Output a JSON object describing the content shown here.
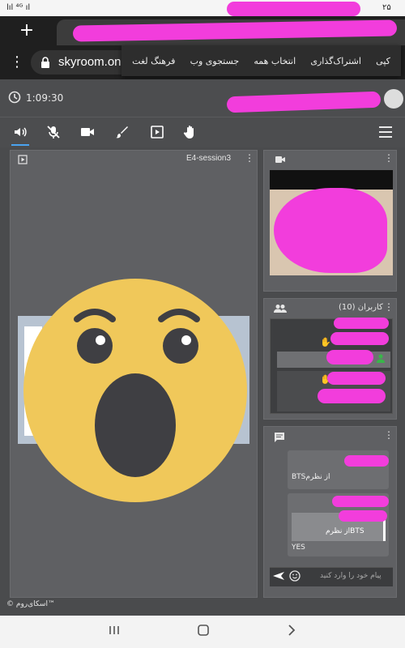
{
  "status": {
    "left": "lıl ⁴ᴳ ıl",
    "right": "۲۵"
  },
  "browser": {
    "new_tab": "+",
    "menu": "⋮",
    "url": "skyroom.onl",
    "context_menu": [
      "کپی",
      "اشتراک‌گذاری",
      "انتخاب همه",
      "جستجوی وب",
      "فرهنگ لغت"
    ]
  },
  "session": {
    "timer": "1:09:30"
  },
  "toolbar": {
    "menu_icon": "hamburger-menu-icon"
  },
  "main": {
    "title": "E4-session3",
    "menu": "⋮"
  },
  "video": {
    "menu": "⋮"
  },
  "users": {
    "title": "کاربران (10)",
    "menu": "⋮"
  },
  "chat": {
    "menu": "⋮",
    "messages": [
      {
        "text": "از نظرمBTS"
      },
      {
        "quote": "BTSاز نظرم",
        "text": "YES"
      }
    ],
    "placeholder": "پیام خود را وارد کنید"
  },
  "footer": {
    "text": "© اسکای‌روم™"
  },
  "colors": {
    "redaction": "#f23ddc",
    "emoji_face": "#f0c85a",
    "accent": "#4aa3f0"
  }
}
